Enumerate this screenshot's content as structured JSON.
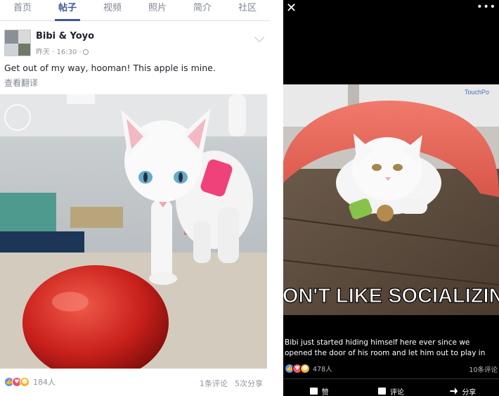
{
  "left": {
    "tabs": [
      {
        "label": "首页",
        "active": false
      },
      {
        "label": "帖子",
        "active": true
      },
      {
        "label": "视频",
        "active": false
      },
      {
        "label": "照片",
        "active": false
      },
      {
        "label": "简介",
        "active": false
      },
      {
        "label": "社区",
        "active": false
      }
    ],
    "post": {
      "author": "Bibi & Yoyo",
      "time": "昨天 · 16:30 ·",
      "text": "Get out of my way, hooman! This apple is mine.",
      "translate": "查看翻译",
      "reaction_count": "184人",
      "comments": "1条评论",
      "shares": "5次分享"
    }
  },
  "right": {
    "meme_text": "I DON'T LIKE SOCIALIZING.",
    "watermark": "TouchPo",
    "caption": "Bibi just started hiding himself here ever since we opened the door of his room and let him out to play in the office. 😂",
    "reaction_count": "478人",
    "comments": "10条评论",
    "actions": {
      "like": "赞",
      "comment": "评论",
      "share": "分享"
    }
  },
  "colors": {
    "brand": "#3b5998",
    "like": "#5890ff",
    "love": "#f25268",
    "haha": "#f7b125"
  }
}
